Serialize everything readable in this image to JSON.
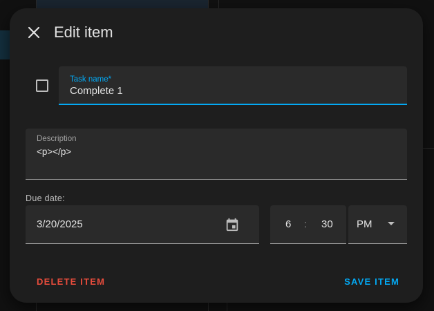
{
  "dialog": {
    "title": "Edit item",
    "close_icon": "close-icon"
  },
  "task": {
    "label": "Task name*",
    "value": "Complete 1",
    "completed": false
  },
  "description": {
    "label": "Description",
    "value": "<p></p>"
  },
  "due": {
    "label": "Due date:",
    "date": "3/20/2025",
    "calendar_icon": "calendar-icon",
    "hour": "6",
    "separator": ":",
    "minute": "30",
    "period": "PM"
  },
  "actions": {
    "delete_label": "DELETE ITEM",
    "save_label": "SAVE ITEM"
  },
  "colors": {
    "accent": "#03a9f4",
    "danger": "#e74c3c",
    "surface": "#1e1e1e",
    "field": "#2a2a2a"
  }
}
